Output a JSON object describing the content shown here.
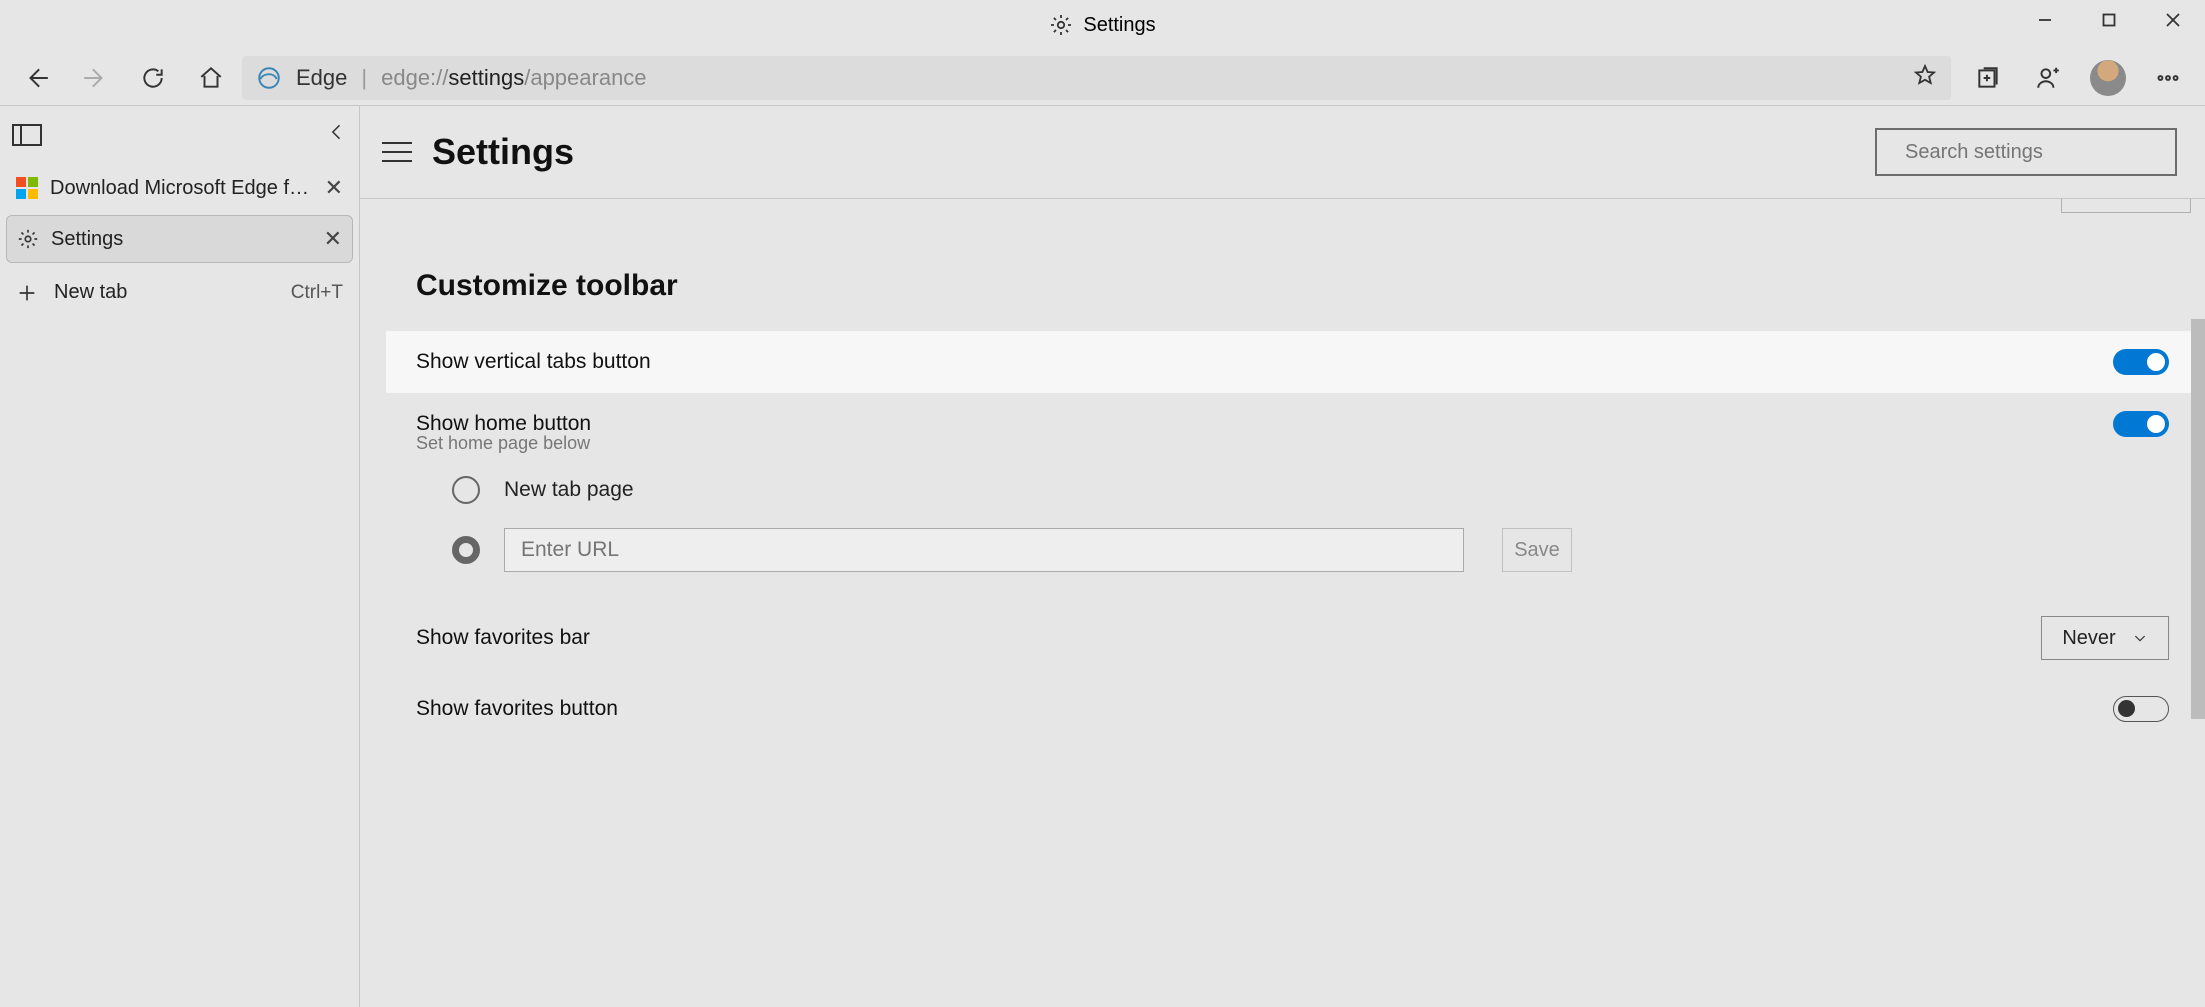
{
  "window": {
    "title": "Settings"
  },
  "toolbar": {
    "browser_label": "Edge",
    "url_prefix": "edge://",
    "url_mid": "settings",
    "url_suffix": "/appearance"
  },
  "vtabs": {
    "tab1_label": "Download Microsoft Edge for Bu",
    "tab2_label": "Settings",
    "newtab_label": "New tab",
    "newtab_shortcut": "Ctrl+T"
  },
  "settings": {
    "page_title": "Settings",
    "search_placeholder": "Search settings",
    "section_title": "Customize toolbar",
    "opt_vertical_tabs": "Show vertical tabs button",
    "opt_home_button": "Show home button",
    "opt_home_sub": "Set home page below",
    "radio_newtab": "New tab page",
    "url_placeholder": "Enter URL",
    "save_label": "Save",
    "opt_favorites_bar": "Show favorites bar",
    "favorites_bar_value": "Never",
    "opt_favorites_button": "Show favorites button"
  }
}
